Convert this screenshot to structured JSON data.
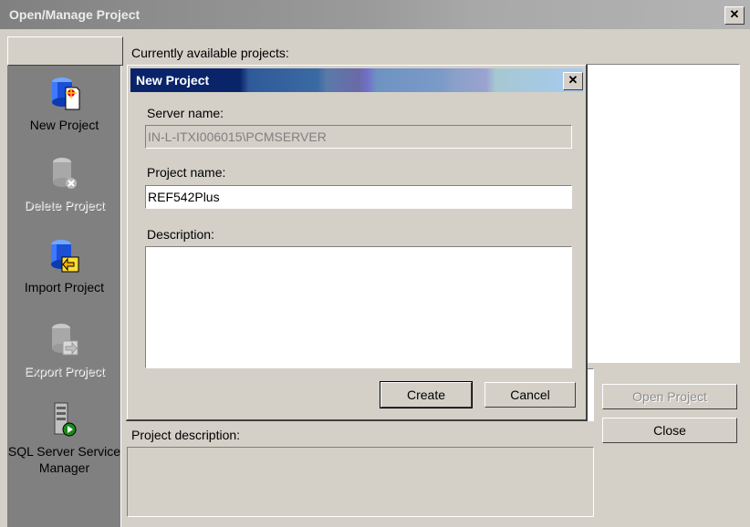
{
  "window": {
    "title": "Open/Manage Project",
    "close_glyph": "✕"
  },
  "toolbar": {
    "items": [
      {
        "label": "New Project",
        "icon": "new-project-icon",
        "enabled": true
      },
      {
        "label": "Delete Project",
        "icon": "delete-project-icon",
        "enabled": false
      },
      {
        "label": "Import Project",
        "icon": "import-project-icon",
        "enabled": true
      },
      {
        "label": "Export Project",
        "icon": "export-project-icon",
        "enabled": false
      },
      {
        "label": "SQL Server Service Manager",
        "icon": "sql-server-service-manager-icon",
        "enabled": true
      }
    ]
  },
  "main": {
    "projects_label": "Currently available projects:",
    "description_label": "Project description:",
    "open_button": "Open Project",
    "close_button": "Close"
  },
  "dialog": {
    "title": "New Project",
    "close_glyph": "✕",
    "server_label": "Server name:",
    "server_value": "IN-L-ITXI006015\\PCMSERVER",
    "project_label": "Project name:",
    "project_value": "REF542Plus",
    "description_label": "Description:",
    "description_value": "",
    "create_button": "Create",
    "cancel_button": "Cancel"
  },
  "colors": {
    "face": "#d4d0c8",
    "dialog_title_dark": "#0a246a",
    "dialog_title_light": "#a6caf0"
  }
}
